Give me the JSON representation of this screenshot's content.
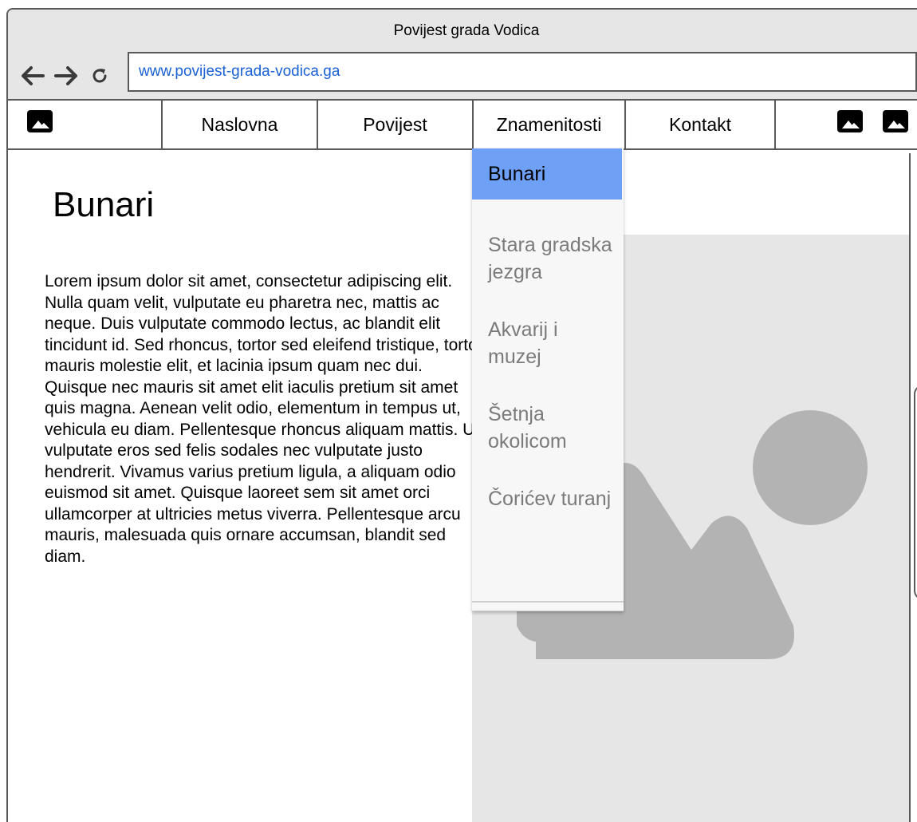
{
  "window": {
    "title": "Povijest grada Vodica"
  },
  "browser": {
    "url": "www.povijest-grada-vodica.ga"
  },
  "nav": {
    "items": [
      "Naslovna",
      "Povijest",
      "Znamenitosti",
      "Kontakt"
    ]
  },
  "page": {
    "title": "Bunari",
    "body": "Lorem ipsum dolor sit amet, consectetur adipiscing elit. Nulla quam velit, vulputate eu pharetra nec, mattis ac neque. Duis vulputate commodo lectus, ac blandit elit tincidunt id. Sed rhoncus, tortor sed eleifend tristique, tortor mauris molestie elit, et lacinia ipsum quam nec dui. Quisque nec mauris sit amet elit iaculis pretium sit amet quis magna. Aenean velit odio, elementum in tempus ut, vehicula eu diam. Pellentesque rhoncus aliquam mattis. Ut vulputate eros sed felis sodales nec vulputate justo hendrerit. Vivamus varius pretium ligula, a aliquam odio euismod sit amet. Quisque laoreet sem sit amet orci ullamcorper at ultricies metus viverra. Pellentesque arcu mauris, malesuada quis ornare accumsan, blandit sed diam."
  },
  "dropdown": {
    "selected": "Bunari",
    "items": [
      "Stara gradska jezgra",
      "Akvarij i muzej",
      "Šetnja okolicom",
      "Čorićev turanj"
    ]
  },
  "icons": [
    "image-icon",
    "arrow-left-icon",
    "arrow-right-icon",
    "reload-icon"
  ],
  "colors": {
    "selected_bg": "#6ea0f5",
    "url_text": "#1a62d6",
    "placeholder_bg": "#e6e6e6",
    "placeholder_shape": "#b3b3b3"
  }
}
